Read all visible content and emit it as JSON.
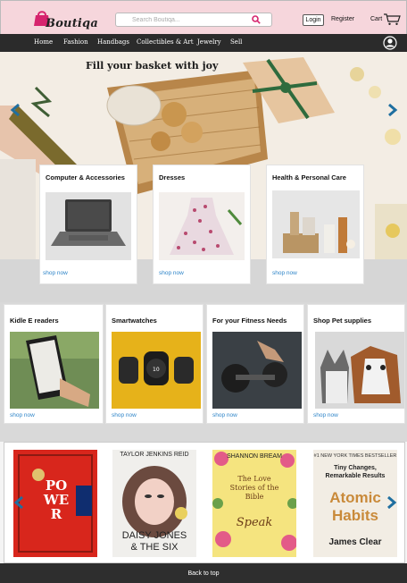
{
  "brand": {
    "logo_text": "Boutiqa"
  },
  "search": {
    "placeholder": "Search Boutiqa..."
  },
  "header": {
    "login_label": "Login",
    "register_label": "Register",
    "cart_label": "Cart"
  },
  "nav": {
    "items": [
      "Home",
      "Fashion",
      "Handbags",
      "Collectibles & Art",
      "Jewelry",
      "Sell"
    ]
  },
  "hero": {
    "title": "Fill your basket with joy"
  },
  "categories_row1": [
    {
      "title": "Computer & Accessories",
      "link": "shop now"
    },
    {
      "title": "Dresses",
      "link": "shop now"
    },
    {
      "title": "Health & Personal Care",
      "link": "shop now"
    }
  ],
  "categories_row2": [
    {
      "title": "Kidle E readers",
      "link": "shop now"
    },
    {
      "title": "Smartwatches",
      "link": "shop now"
    },
    {
      "title": "For your Fitness Needs",
      "link": "shop now"
    },
    {
      "title": "Shop Pet supplies",
      "link": "shop now"
    }
  ],
  "books": [
    {
      "top": "",
      "title": "POWER",
      "sub": "",
      "author": ""
    },
    {
      "top": "TAYLOR JENKINS REID",
      "title": "DAISY JONES",
      "sub": "& THE SIX",
      "author": ""
    },
    {
      "top": "SHANNON BREAM",
      "title": "The Love Stories of the Bible",
      "sub": "Speak",
      "author": ""
    },
    {
      "top": "#1 NEW YORK TIMES BESTSELLER",
      "title": "Atomic Habits",
      "sub": "Tiny Changes, Remarkable Results",
      "author": "James Clear"
    }
  ],
  "footer": {
    "back_to_top": "Back to top"
  },
  "colors": {
    "header_bg": "#f6d6dc",
    "nav_bg": "#2b2b2b",
    "accent": "#d6246e",
    "link": "#2d84c8",
    "arrow": "#1f6fa0"
  }
}
